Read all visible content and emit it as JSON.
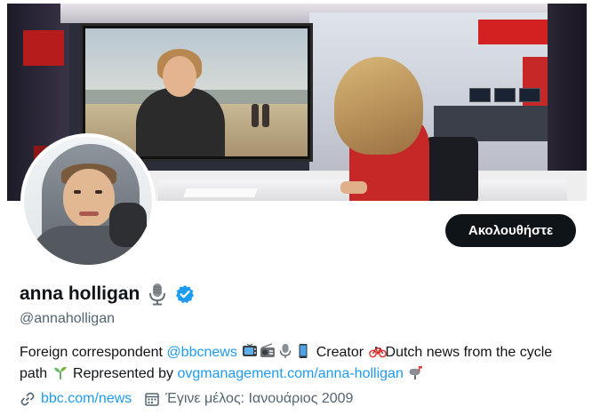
{
  "profile": {
    "display_name": "anna holligan",
    "handle": "@annaholligan",
    "follow_label": "Ακολουθήστε",
    "bio": {
      "part1": "Foreign correspondent ",
      "link1": "@bbcnews",
      "part2": " Creator ",
      "part3": "Dutch news from the cycle path ",
      "part4": " Represented by ",
      "link2": "ovgmanagement.com/anna-holligan"
    },
    "website": "bbc.com/news",
    "joined": "Έγινε μέλος: Ιανουάριος 2009"
  },
  "icons": {
    "name_badge": "microphone-icon",
    "verified": "verified-badge-icon",
    "bio_emojis": [
      "tv-icon",
      "radio-icon",
      "microphone-icon",
      "mobile-phone-icon",
      "bicycle-icon",
      "seedling-icon",
      "mailbox-icon"
    ],
    "website": "link-icon",
    "joined": "calendar-icon"
  },
  "colors": {
    "accent": "#1d9bf0",
    "button_bg": "#0f1419",
    "button_text": "#ffffff",
    "secondary_text": "#536471",
    "primary_text": "#0f1419"
  }
}
